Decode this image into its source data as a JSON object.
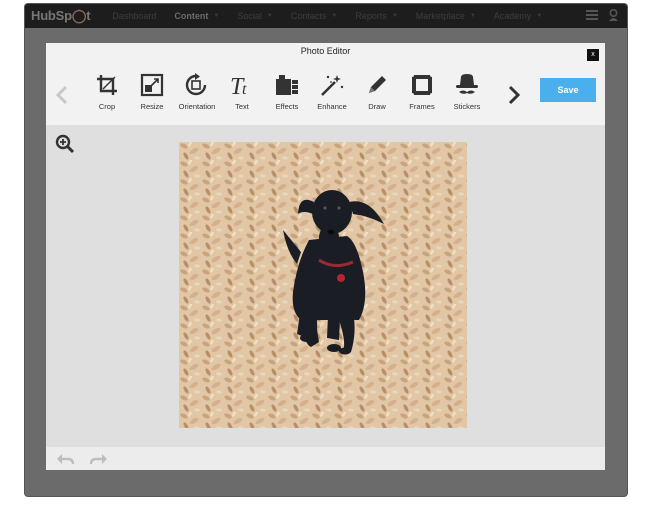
{
  "app": {
    "logo_part1": "HubSp",
    "logo_part2": "t",
    "nav": [
      {
        "label": "Dashboard"
      },
      {
        "label": "Content"
      },
      {
        "label": "Social"
      },
      {
        "label": "Contacts"
      },
      {
        "label": "Reports"
      },
      {
        "label": "Marketplace"
      },
      {
        "label": "Academy"
      }
    ]
  },
  "modal": {
    "title": "Photo Editor",
    "close_label": "x",
    "tools": [
      {
        "label": "Crop",
        "icon": "crop-icon"
      },
      {
        "label": "Resize",
        "icon": "resize-icon"
      },
      {
        "label": "Orientation",
        "icon": "orientation-icon"
      },
      {
        "label": "Text",
        "icon": "text-icon"
      },
      {
        "label": "Effects",
        "icon": "effects-icon"
      },
      {
        "label": "Enhance",
        "icon": "enhance-icon"
      },
      {
        "label": "Draw",
        "icon": "draw-icon"
      },
      {
        "label": "Frames",
        "icon": "frames-icon"
      },
      {
        "label": "Stickers",
        "icon": "stickers-icon"
      }
    ],
    "save_label": "Save",
    "photo_description_icon": "dog-photo"
  },
  "colors": {
    "save_button": "#49b0ed",
    "modal_bg": "#f2f2f2",
    "canvas_bg": "#dfdfdf",
    "nav_bg": "#1d1d1d"
  }
}
